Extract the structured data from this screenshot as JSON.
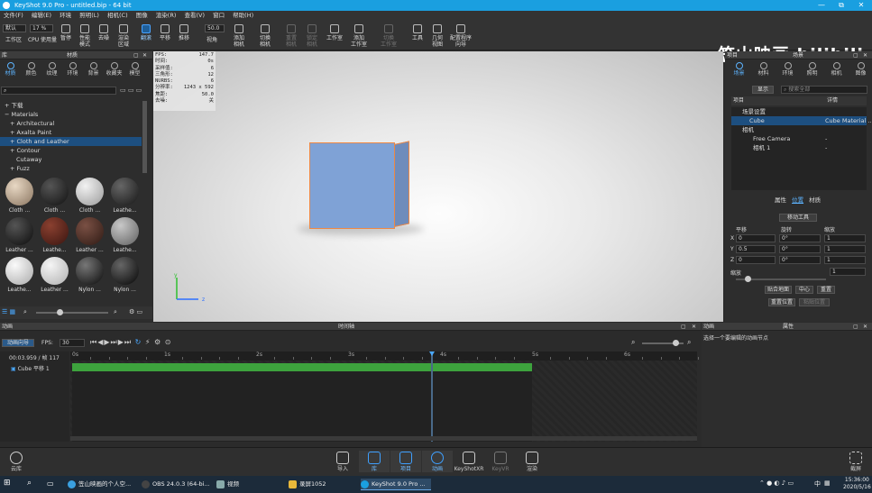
{
  "window": {
    "title": "KeyShot 9.0 Pro - untitled.bip - 64 bit",
    "minimize": "—",
    "restore": "⧉",
    "close": "✕"
  },
  "menu": [
    "文件(F)",
    "编辑(E)",
    "环境",
    "照明(L)",
    "相机(C)",
    "图像",
    "渲染(R)",
    "查看(V)",
    "窗口",
    "帮助(H)"
  ],
  "toolbar": {
    "workspace_select": "默认",
    "zoom_value": "17 %",
    "cpu_label": "工作区",
    "cpu_usage": "CPU 使用量",
    "pause": "暂停",
    "perf_mode": "性能\n模式",
    "denoise": "去噪",
    "render_region": "渲染\n区域",
    "tumble": "翻滚",
    "pan": "平移",
    "dolly": "推移",
    "fov_value": "50.0",
    "view": "视角",
    "add_camera": "添加\n相机",
    "switch_camera": "切换\n相机",
    "reset_camera": "重置\n相机",
    "lock_camera": "锁定\n相机",
    "workspace": "工作室",
    "add_workspace": "添加\n工作室",
    "switch_workspace": "切换\n工作室",
    "tools": "工具",
    "geometry_view": "几何\n视图",
    "config_wizard": "配置程序\n向导"
  },
  "brand": "笠山映画 bilibili",
  "library": {
    "header_left": "库",
    "header": "材质",
    "tabs": [
      "材质",
      "颜色",
      "纹理",
      "环境",
      "背景",
      "收藏夹",
      "模型"
    ],
    "tree": [
      "下载",
      "Materials",
      "Architectural",
      "Axalta Paint",
      "Cloth and Leather",
      "Contour",
      "Cutaway",
      "Fuzz"
    ],
    "thumbs": [
      "Cloth ...",
      "Cloth ...",
      "Cloth ...",
      "Leathe...",
      "Leather ...",
      "Leathe...",
      "Leather ...",
      "Leathe...",
      "Leathe...",
      "Leather ...",
      "Nylon ...",
      "Nylon ..."
    ]
  },
  "hud": [
    [
      "FPS:",
      "147.7"
    ],
    [
      "时间:",
      "0s"
    ],
    [
      "采样值:",
      "6"
    ],
    [
      "三角形:",
      "12"
    ],
    [
      "NURBS:",
      "6"
    ],
    [
      "分辨率:",
      "1243 x 592"
    ],
    [
      "焦距:",
      "50.0"
    ],
    [
      "去噪:",
      "关"
    ]
  ],
  "project": {
    "header_left": "项目",
    "header": "场景",
    "tabs": [
      "场景",
      "材料",
      "环境",
      "照明",
      "相机",
      "图像"
    ],
    "show_btn": "显示",
    "search_placeholder": "搜索全部",
    "col_item": "项目",
    "col_detail": "详情",
    "tree": [
      {
        "name": "场景设置",
        "detail": ""
      },
      {
        "name": "Cube",
        "detail": "Cube Material ..."
      },
      {
        "name": "相机",
        "detail": ""
      },
      {
        "name": "Free Camera",
        "detail": "-"
      },
      {
        "name": "相机 1",
        "detail": "-"
      }
    ],
    "subtabs": [
      "属性",
      "位置",
      "材质"
    ],
    "move_tool": "移动工具",
    "col_translate": "平移",
    "col_rotate": "旋转",
    "col_scale": "缩放",
    "rows": [
      {
        "axis": "X",
        "t": "0",
        "r": "0°",
        "s": "1"
      },
      {
        "axis": "Y",
        "t": "0.5",
        "r": "0°",
        "s": "1"
      },
      {
        "axis": "Z",
        "t": "0",
        "r": "0°",
        "s": "1"
      }
    ],
    "uniform_scale": "缩放",
    "uniform_value": "1",
    "btn_ground": "贴合地面",
    "btn_center": "中心",
    "btn_reset": "重置",
    "btn_reset_pos": "重置位置",
    "btn_paste_pos": "粘贴位置"
  },
  "timeline": {
    "header_left": "动画",
    "header": "时间轴",
    "wizard_btn": "动画向导",
    "fps_label": "FPS:",
    "fps_value": "30",
    "time_display": "00:03.959 / 帧 117",
    "track": "Cube 平移 1",
    "ticks": [
      "0s",
      "1s",
      "2s",
      "3s",
      "4s",
      "5s",
      "6s"
    ],
    "playhead": 3.9,
    "clip_end": 5.0
  },
  "anim_props": {
    "header_left": "动画",
    "header": "属性",
    "hint": "选择一个要编辑的动画节点"
  },
  "bottombar": {
    "cloud": "云库",
    "import": "导入",
    "library": "库",
    "project": "项目",
    "animation": "动画",
    "keyshotxr": "KeyShotXR",
    "keyvr": "KeyVR",
    "render": "渲染",
    "screenshot": "截屏"
  },
  "taskbar": {
    "apps": [
      "笠山映画的个人空...",
      "OBS 24.0.3 (64-bi...",
      "视频",
      "录屏1052",
      "KeyShot 9.0 Pro ..."
    ],
    "ime": "中",
    "time": "15:36:00",
    "date": "2020/5/16"
  },
  "colors": {
    "accent": "#1a9fe0",
    "cube": "#7fa2d6",
    "outline": "#ee8844",
    "clip": "#3da33d",
    "selection": "#1d4f80"
  }
}
